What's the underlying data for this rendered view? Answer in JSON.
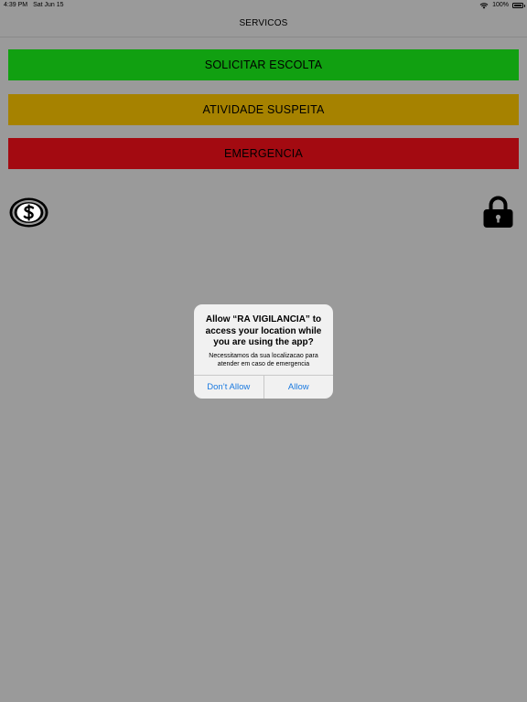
{
  "status_bar": {
    "time": "4:39 PM",
    "date": "Sat Jun 15",
    "battery": "100%",
    "battery_level": 1.0
  },
  "nav": {
    "title": "SERVICOS"
  },
  "buttons": {
    "escolta": "SOLICITAR ESCOLTA",
    "suspeita": "ATIVIDADE SUSPEITA",
    "emergencia": "EMERGENCIA"
  },
  "colors": {
    "background": "#9a9a9a",
    "escolta": "#11a011",
    "suspeita": "#a68200",
    "emergencia": "#a30a11",
    "alert_action": "#1b7ae0"
  },
  "icons": {
    "left": "dollar-coin-icon",
    "right": "lock-icon"
  },
  "alert": {
    "title": "Allow “RA VIGILANCIA” to access your location while you are using the app?",
    "message": "Necessitamos da sua localizacao para atender em caso de emergencia",
    "deny_label": "Don’t Allow",
    "allow_label": "Allow"
  }
}
